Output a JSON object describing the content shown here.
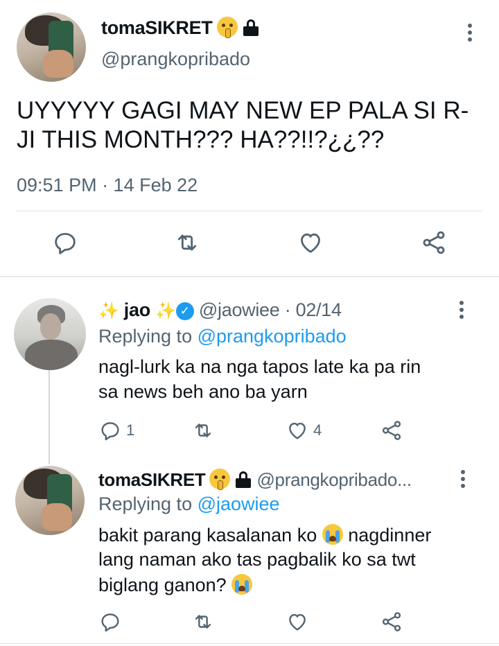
{
  "main_tweet": {
    "name": "tomaSIKRET",
    "handle": "@prangkopribado",
    "text_line1": "UYYYYY GAGI MAY NEW EP PALA SI R-",
    "text_line2": "JI THIS MONTH??? HA??!!?¿¿??",
    "timestamp": "09:51 PM · 14 Feb 22",
    "icons": [
      "shushing-face-emoji",
      "lock-icon",
      "more-options-icon",
      "reply-icon",
      "retweet-icon",
      "like-icon",
      "share-icon"
    ]
  },
  "reply1": {
    "name": "jao",
    "handle": "@jaowiee",
    "separator": " · ",
    "date": "02/14",
    "replying_prefix": "Replying to ",
    "replying_handle": "@prangkopribado",
    "text_line1": "nagl-lurk ka na nga tapos late ka pa rin",
    "text_line2": "sa news beh ano ba yarn",
    "reply_count": "1",
    "like_count": "4",
    "icons": [
      "sparkles-emoji",
      "verified-badge-icon"
    ]
  },
  "reply2": {
    "name": "tomaSIKRET",
    "handle": "@prangkopribado...",
    "replying_prefix": "Replying to ",
    "replying_handle": "@jaowiee",
    "text_line1_a": "bakit parang kasalanan ko ",
    "text_line1_b": " nagdinner",
    "text_line2": "lang naman ako tas pagbalik ko sa twt",
    "text_line3": "biglang ganon? ",
    "icons": [
      "loudly-crying-face-emoji"
    ]
  },
  "colors": {
    "text": "#0f1419",
    "muted": "#536471",
    "accent": "#1d9bf0",
    "divider": "#dfe3e6"
  }
}
